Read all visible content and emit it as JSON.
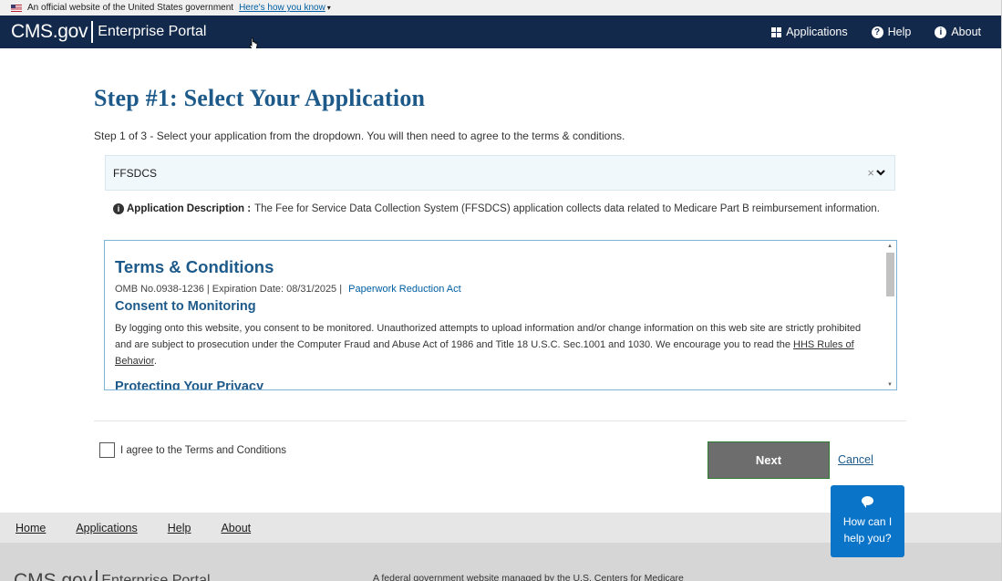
{
  "gov_banner": {
    "text": "An official website of the United States government",
    "link": "Here's how you know"
  },
  "header": {
    "brand_cms": "CMS.gov",
    "brand_portal": "Enterprise Portal",
    "nav": [
      {
        "label": "Applications",
        "icon": "grid-icon"
      },
      {
        "label": "Help",
        "icon": "question-circle-icon"
      },
      {
        "label": "About",
        "icon": "info-circle-icon"
      }
    ]
  },
  "page": {
    "title": "Step #1: Select Your Application",
    "step_text": "Step 1 of 3 - Select your application from the dropdown. You will then need to agree to the terms & conditions."
  },
  "select": {
    "value": "FFSDCS",
    "clear": "×"
  },
  "app_description": {
    "label": "Application Description :",
    "text": "The Fee for Service Data Collection System (FFSDCS) application collects data related to Medicare Part B reimbursement information."
  },
  "terms": {
    "title": "Terms & Conditions",
    "omb": "OMB No.0938-1236 | Expiration Date: 08/31/2025 |",
    "omb_link": "Paperwork Reduction Act",
    "consent_heading": "Consent to Monitoring",
    "consent_text": "By logging onto this website, you consent to be monitored. Unauthorized attempts to upload information and/or change information on this web site are strictly prohibited and are subject to prosecution under the Computer Fraud and Abuse Act of 1986 and Title 18 U.S.C. Sec.1001 and 1030. We encourage you to read the ",
    "consent_link": "HHS Rules of Behavior",
    "consent_end": ".",
    "privacy_heading": "Protecting Your Privacy"
  },
  "agree": {
    "label": "I agree to the Terms and Conditions"
  },
  "buttons": {
    "next": "Next",
    "cancel": "Cancel"
  },
  "footer": {
    "nav": [
      "Home",
      "Applications",
      "Help",
      "About"
    ],
    "brand_cms": "CMS.gov",
    "brand_portal": "Enterprise Portal",
    "text": "A federal government website managed by the U.S. Centers for Medicare"
  },
  "chat": {
    "line1": "How can I",
    "line2": "help you?"
  }
}
